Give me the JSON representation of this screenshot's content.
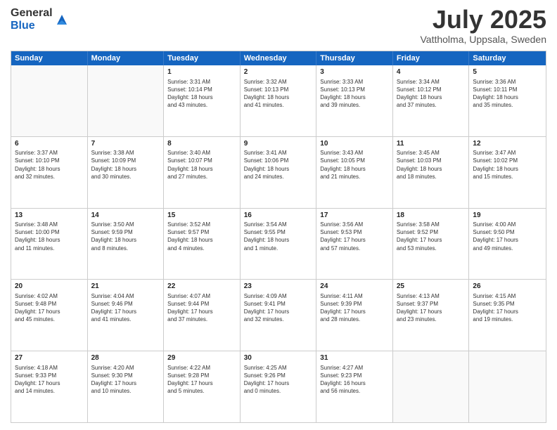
{
  "header": {
    "logo_general": "General",
    "logo_blue": "Blue",
    "month_title": "July 2025",
    "location": "Vattholma, Uppsala, Sweden"
  },
  "calendar": {
    "days_of_week": [
      "Sunday",
      "Monday",
      "Tuesday",
      "Wednesday",
      "Thursday",
      "Friday",
      "Saturday"
    ],
    "rows": [
      [
        {
          "day": "",
          "info": ""
        },
        {
          "day": "",
          "info": ""
        },
        {
          "day": "1",
          "info": "Sunrise: 3:31 AM\nSunset: 10:14 PM\nDaylight: 18 hours\nand 43 minutes."
        },
        {
          "day": "2",
          "info": "Sunrise: 3:32 AM\nSunset: 10:13 PM\nDaylight: 18 hours\nand 41 minutes."
        },
        {
          "day": "3",
          "info": "Sunrise: 3:33 AM\nSunset: 10:13 PM\nDaylight: 18 hours\nand 39 minutes."
        },
        {
          "day": "4",
          "info": "Sunrise: 3:34 AM\nSunset: 10:12 PM\nDaylight: 18 hours\nand 37 minutes."
        },
        {
          "day": "5",
          "info": "Sunrise: 3:36 AM\nSunset: 10:11 PM\nDaylight: 18 hours\nand 35 minutes."
        }
      ],
      [
        {
          "day": "6",
          "info": "Sunrise: 3:37 AM\nSunset: 10:10 PM\nDaylight: 18 hours\nand 32 minutes."
        },
        {
          "day": "7",
          "info": "Sunrise: 3:38 AM\nSunset: 10:09 PM\nDaylight: 18 hours\nand 30 minutes."
        },
        {
          "day": "8",
          "info": "Sunrise: 3:40 AM\nSunset: 10:07 PM\nDaylight: 18 hours\nand 27 minutes."
        },
        {
          "day": "9",
          "info": "Sunrise: 3:41 AM\nSunset: 10:06 PM\nDaylight: 18 hours\nand 24 minutes."
        },
        {
          "day": "10",
          "info": "Sunrise: 3:43 AM\nSunset: 10:05 PM\nDaylight: 18 hours\nand 21 minutes."
        },
        {
          "day": "11",
          "info": "Sunrise: 3:45 AM\nSunset: 10:03 PM\nDaylight: 18 hours\nand 18 minutes."
        },
        {
          "day": "12",
          "info": "Sunrise: 3:47 AM\nSunset: 10:02 PM\nDaylight: 18 hours\nand 15 minutes."
        }
      ],
      [
        {
          "day": "13",
          "info": "Sunrise: 3:48 AM\nSunset: 10:00 PM\nDaylight: 18 hours\nand 11 minutes."
        },
        {
          "day": "14",
          "info": "Sunrise: 3:50 AM\nSunset: 9:59 PM\nDaylight: 18 hours\nand 8 minutes."
        },
        {
          "day": "15",
          "info": "Sunrise: 3:52 AM\nSunset: 9:57 PM\nDaylight: 18 hours\nand 4 minutes."
        },
        {
          "day": "16",
          "info": "Sunrise: 3:54 AM\nSunset: 9:55 PM\nDaylight: 18 hours\nand 1 minute."
        },
        {
          "day": "17",
          "info": "Sunrise: 3:56 AM\nSunset: 9:53 PM\nDaylight: 17 hours\nand 57 minutes."
        },
        {
          "day": "18",
          "info": "Sunrise: 3:58 AM\nSunset: 9:52 PM\nDaylight: 17 hours\nand 53 minutes."
        },
        {
          "day": "19",
          "info": "Sunrise: 4:00 AM\nSunset: 9:50 PM\nDaylight: 17 hours\nand 49 minutes."
        }
      ],
      [
        {
          "day": "20",
          "info": "Sunrise: 4:02 AM\nSunset: 9:48 PM\nDaylight: 17 hours\nand 45 minutes."
        },
        {
          "day": "21",
          "info": "Sunrise: 4:04 AM\nSunset: 9:46 PM\nDaylight: 17 hours\nand 41 minutes."
        },
        {
          "day": "22",
          "info": "Sunrise: 4:07 AM\nSunset: 9:44 PM\nDaylight: 17 hours\nand 37 minutes."
        },
        {
          "day": "23",
          "info": "Sunrise: 4:09 AM\nSunset: 9:41 PM\nDaylight: 17 hours\nand 32 minutes."
        },
        {
          "day": "24",
          "info": "Sunrise: 4:11 AM\nSunset: 9:39 PM\nDaylight: 17 hours\nand 28 minutes."
        },
        {
          "day": "25",
          "info": "Sunrise: 4:13 AM\nSunset: 9:37 PM\nDaylight: 17 hours\nand 23 minutes."
        },
        {
          "day": "26",
          "info": "Sunrise: 4:15 AM\nSunset: 9:35 PM\nDaylight: 17 hours\nand 19 minutes."
        }
      ],
      [
        {
          "day": "27",
          "info": "Sunrise: 4:18 AM\nSunset: 9:33 PM\nDaylight: 17 hours\nand 14 minutes."
        },
        {
          "day": "28",
          "info": "Sunrise: 4:20 AM\nSunset: 9:30 PM\nDaylight: 17 hours\nand 10 minutes."
        },
        {
          "day": "29",
          "info": "Sunrise: 4:22 AM\nSunset: 9:28 PM\nDaylight: 17 hours\nand 5 minutes."
        },
        {
          "day": "30",
          "info": "Sunrise: 4:25 AM\nSunset: 9:26 PM\nDaylight: 17 hours\nand 0 minutes."
        },
        {
          "day": "31",
          "info": "Sunrise: 4:27 AM\nSunset: 9:23 PM\nDaylight: 16 hours\nand 56 minutes."
        },
        {
          "day": "",
          "info": ""
        },
        {
          "day": "",
          "info": ""
        }
      ]
    ]
  }
}
